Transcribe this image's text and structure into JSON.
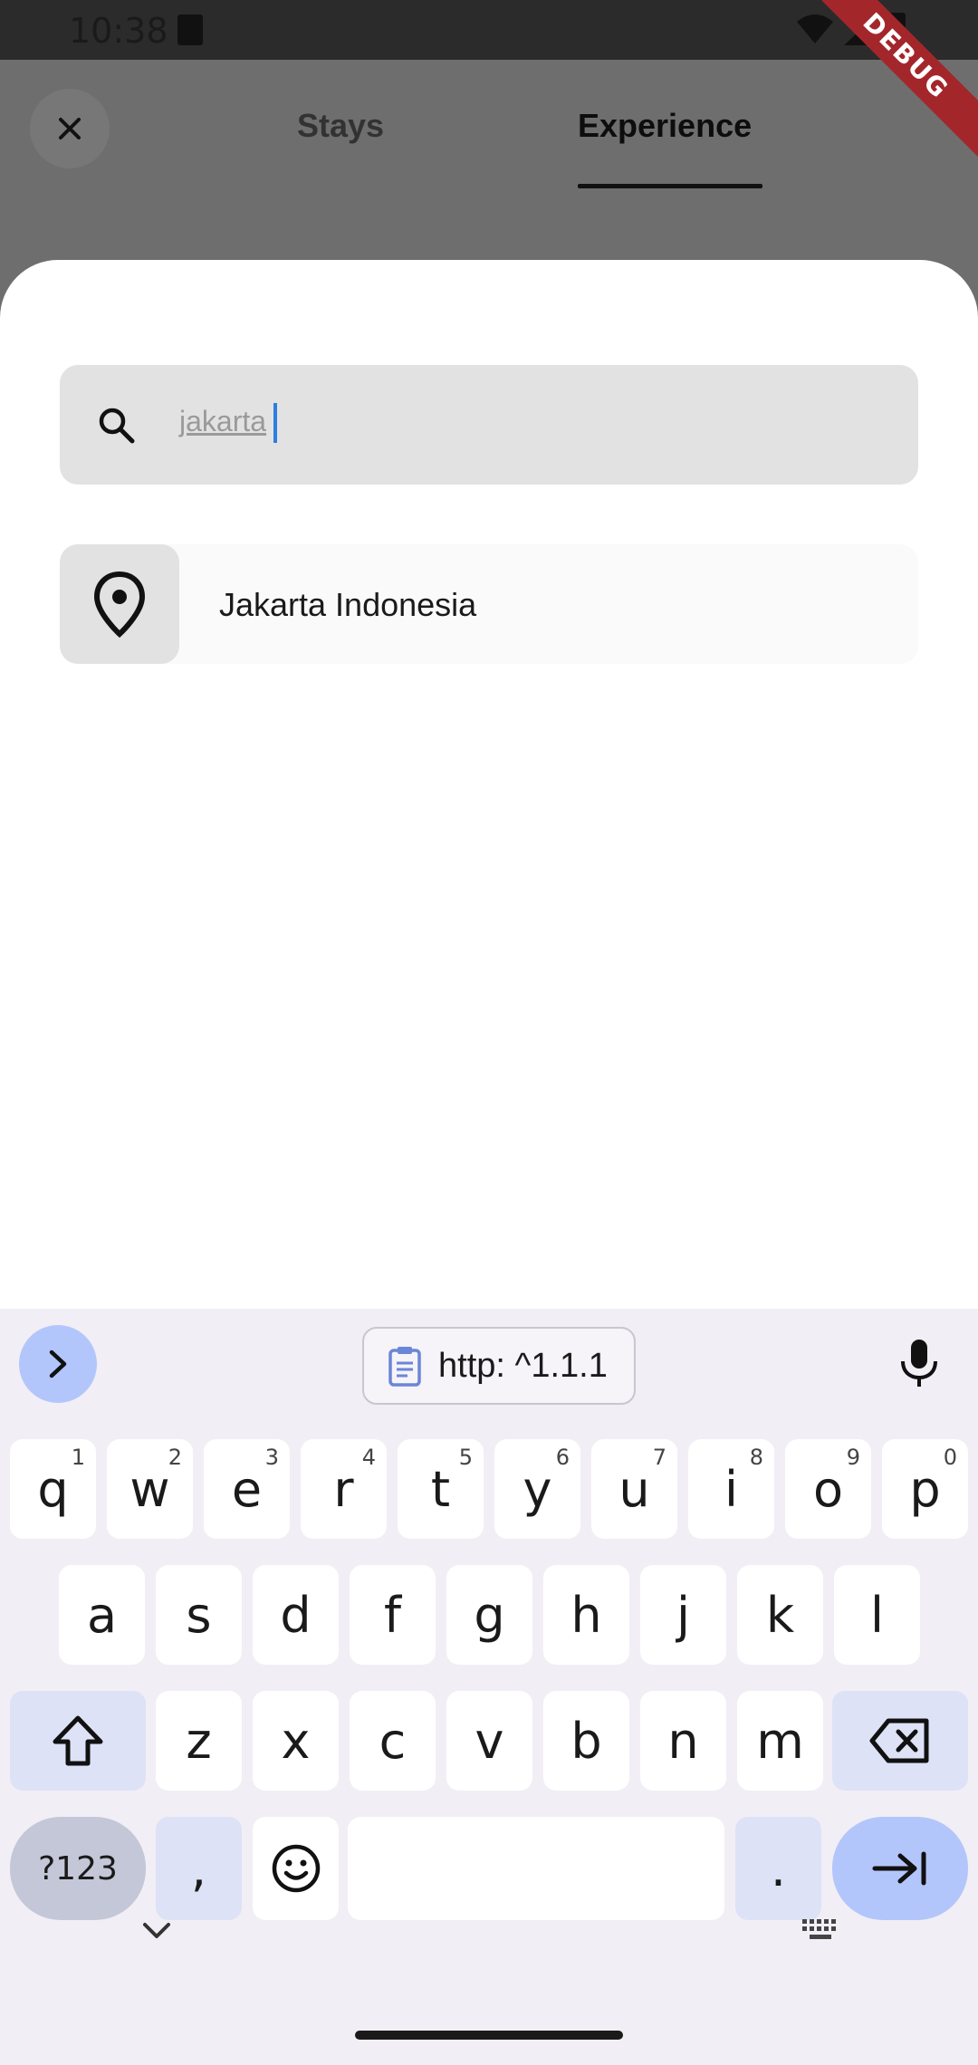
{
  "status_bar": {
    "time": "10:38"
  },
  "debug_banner": "DEBUG",
  "nav": {
    "tabs": [
      {
        "label": "Stays",
        "active": false
      },
      {
        "label": "Experience",
        "active": true
      }
    ]
  },
  "search": {
    "value": "jakarta"
  },
  "results": [
    {
      "label": "Jakarta Indonesia",
      "icon": "location-pin-icon"
    }
  ],
  "keyboard": {
    "clipboard_suggestion": "http: ^1.1.1",
    "row1": [
      {
        "key": "q",
        "hint": "1"
      },
      {
        "key": "w",
        "hint": "2"
      },
      {
        "key": "e",
        "hint": "3"
      },
      {
        "key": "r",
        "hint": "4"
      },
      {
        "key": "t",
        "hint": "5"
      },
      {
        "key": "y",
        "hint": "6"
      },
      {
        "key": "u",
        "hint": "7"
      },
      {
        "key": "i",
        "hint": "8"
      },
      {
        "key": "o",
        "hint": "9"
      },
      {
        "key": "p",
        "hint": "0"
      }
    ],
    "row2": [
      "a",
      "s",
      "d",
      "f",
      "g",
      "h",
      "j",
      "k",
      "l"
    ],
    "row3": [
      "z",
      "x",
      "c",
      "v",
      "b",
      "n",
      "m"
    ],
    "symbols_label": "?123",
    "comma": ",",
    "period": "."
  },
  "colors": {
    "accent_blue": "#b3c6fb",
    "caret": "#2a7fe0",
    "debug_red": "#a3262b"
  }
}
